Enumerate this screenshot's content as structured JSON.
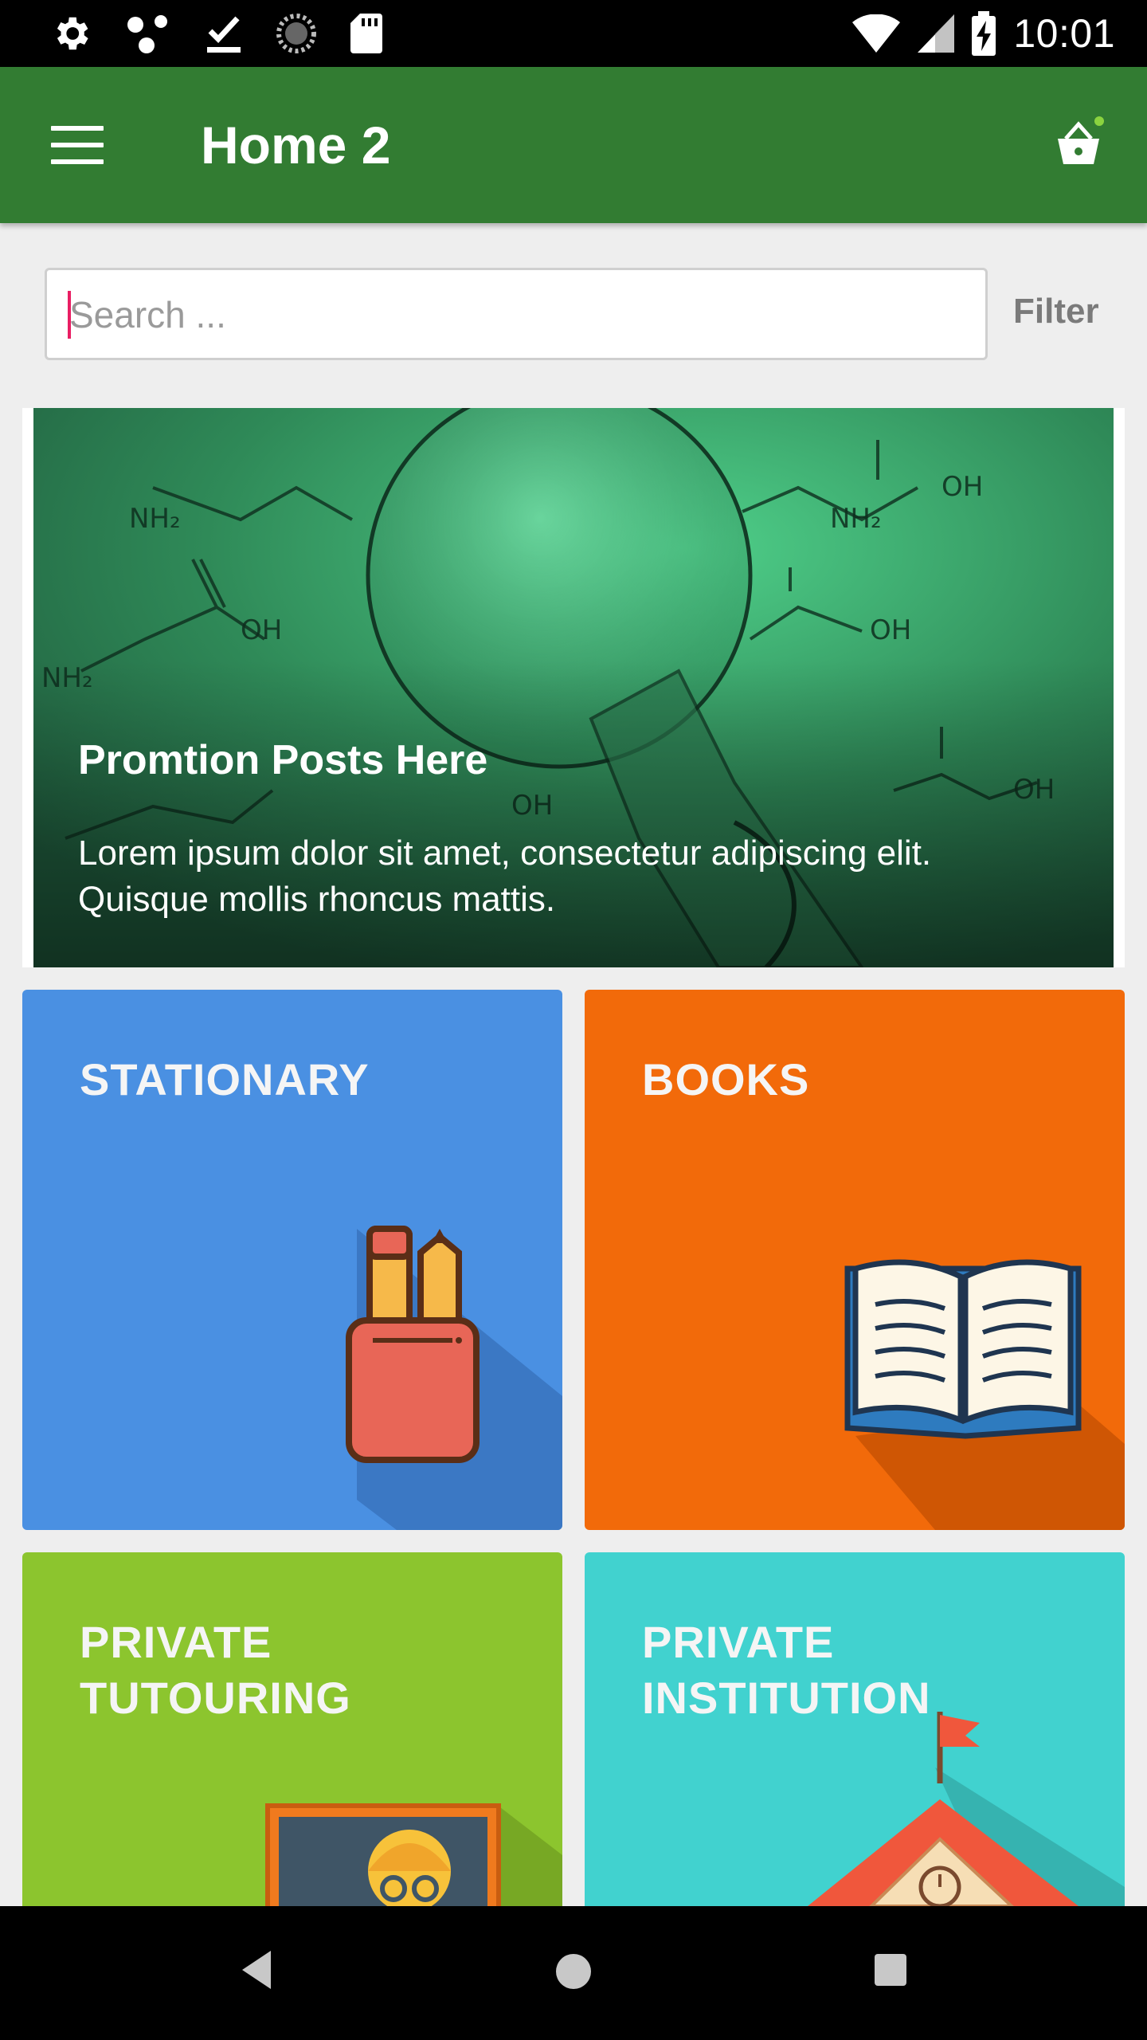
{
  "status_bar": {
    "time": "10:01",
    "left_icons": [
      "settings-icon",
      "dots-icon",
      "download-done-icon",
      "sync-circle-icon",
      "sd-card-icon"
    ],
    "right_icons": [
      "wifi-icon",
      "signal-icon",
      "battery-charging-icon"
    ]
  },
  "app_bar": {
    "title": "Home 2",
    "menu_icon": "hamburger-menu-icon",
    "cart_icon": "shopping-basket-icon",
    "badge_color": "#8bd33f"
  },
  "search": {
    "placeholder": "Search ...",
    "value": "",
    "filter_label": "Filter"
  },
  "promotion": {
    "title": "Promtion Posts Here",
    "description": "Lorem ipsum dolor sit amet, consectetur adipiscing elit. Quisque mollis rhoncus mattis."
  },
  "categories": [
    {
      "label": "STATIONARY",
      "icon": "pencil-cup-icon",
      "color": "#4a90e2"
    },
    {
      "label": "BOOKS",
      "icon": "open-book-icon",
      "color": "#f26a0a"
    },
    {
      "label": "PRIVATE\nTUTOURING",
      "icon": "tutor-board-icon",
      "color": "#8cc52e"
    },
    {
      "label": "PRIVATE\nINSTITUTION",
      "icon": "school-building-icon",
      "color": "#41d2cf"
    }
  ],
  "colors": {
    "app_bar": "#327c32",
    "background": "#eeeeee",
    "accent_cursor": "#e91e63"
  },
  "nav_bar": {
    "buttons": [
      "back-icon",
      "home-icon",
      "recents-icon"
    ]
  }
}
